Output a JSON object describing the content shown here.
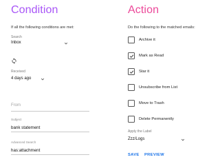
{
  "condition": {
    "heading": "Condition",
    "intro": "If all the following conditions are met:",
    "search": {
      "label": "Search",
      "value": "Inbox"
    },
    "refresh_icon": "refresh-icon",
    "received": {
      "label": "Received",
      "value": "4 days ago"
    },
    "from": {
      "placeholder": "From"
    },
    "subject": {
      "label": "Subject",
      "value": "bank statement"
    },
    "advanced": {
      "label": "Advanced Search",
      "value": "has:attachment"
    }
  },
  "action": {
    "heading": "Action",
    "intro": "Do the following to the matched emails:",
    "options": [
      {
        "label": "Archive it",
        "checked": false
      },
      {
        "label": "Mark as Read",
        "checked": true
      },
      {
        "label": "Star it",
        "checked": true
      },
      {
        "label": "Unsubscribe from List",
        "checked": false
      },
      {
        "label": "Move to Trash",
        "checked": false
      },
      {
        "label": "Delete Permanently",
        "checked": false
      }
    ],
    "apply_label": {
      "label": "Apply the Label",
      "value": "Zzz/Logs"
    },
    "save_label": "SAVE",
    "preview_label": "PREVIEW"
  },
  "colors": {
    "condition_heading": "#a855f7",
    "action_heading": "#ec4899",
    "button": "#1a73e8"
  }
}
